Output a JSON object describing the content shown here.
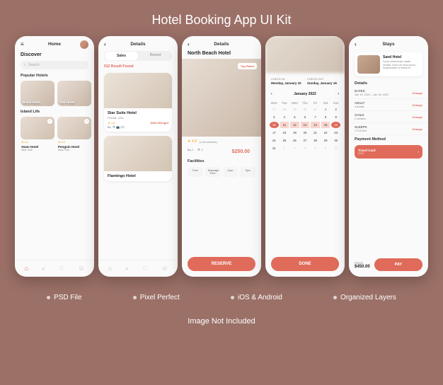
{
  "title": "Hotel Booking App UI Kit",
  "features": [
    "PSD File",
    "Pixel Perfect",
    "iOS & Android",
    "Organized Layers"
  ],
  "footer": "Image Not Included",
  "colors": {
    "accent": "#e06b5a",
    "bg": "#9b7067"
  },
  "screen1": {
    "header": "Home",
    "discover": "Discover",
    "search_placeholder": "Search",
    "popular_label": "Popular Hotels",
    "popular": [
      {
        "name": "Bakul Hotel"
      },
      {
        "name": "Star Hotel"
      }
    ],
    "island_label": "Island Life",
    "island": [
      {
        "name": "Swan Hotel",
        "loc": "New York",
        "rating": "★ 4.8"
      },
      {
        "name": "Penguin Hotel",
        "loc": "New York",
        "rating": "★ 4.8"
      }
    ]
  },
  "screen2": {
    "header": "Details",
    "tabs": {
      "a": "Sales",
      "b": "Recent"
    },
    "result_count": "512 Result Found",
    "cards": [
      {
        "name": "Star Suite Hotel",
        "loc": "Florida, USA",
        "rating": "★ 4.8",
        "icons": "🛏 🚿 📺 🍽",
        "price": "$400.00/night"
      },
      {
        "name": "Flamingo Hotel",
        "loc": "",
        "rating": "",
        "price": ""
      }
    ]
  },
  "screen3": {
    "header": "Details",
    "title": "North Beach Hotel",
    "badge": "Top Rated",
    "rating": "★ 4.8",
    "reviews": "(1.6k reviews)",
    "beds": "🛏 2",
    "baths": "🚿 2",
    "price": "$250.00",
    "facilities_label": "Facilities",
    "facilities": [
      "Pool",
      "Massage Free",
      "Gym",
      "Spa"
    ],
    "reserve": "RESERVE"
  },
  "screen4": {
    "checkin_label": "CHECK-IN",
    "checkin": "Monday, January 10",
    "checkout_label": "CHECK-OUT",
    "checkout": "Sunday, January 16",
    "month": "January 2022",
    "daynames": [
      "Mon",
      "Tue",
      "Wed",
      "Thu",
      "Fri",
      "Sat",
      "Sun"
    ],
    "done": "DONE"
  },
  "screen5": {
    "header": "Stays",
    "hotel": "Sand Hotel",
    "desc": "Fusce ullamcorper mattis semper. Nunc vel risus ipsum. Suspendisse ut metus mi.",
    "details_label": "Details",
    "rows": {
      "dates": {
        "label": "DATES",
        "value": "Jan 10, 2022 – Jan 18, 2022"
      },
      "adult": {
        "label": "ADULT",
        "value": "4 Adults"
      },
      "child": {
        "label": "CHILD",
        "value": "2 children"
      },
      "sleeps": {
        "label": "SLEEPS",
        "value": "1 Full Bed"
      }
    },
    "change": "Change",
    "payment_label": "Payment Method",
    "card": {
      "name": "Travel Card",
      "last": "2720"
    },
    "price_label": "PRICE",
    "price": "$450.00",
    "pay": "PAY"
  }
}
